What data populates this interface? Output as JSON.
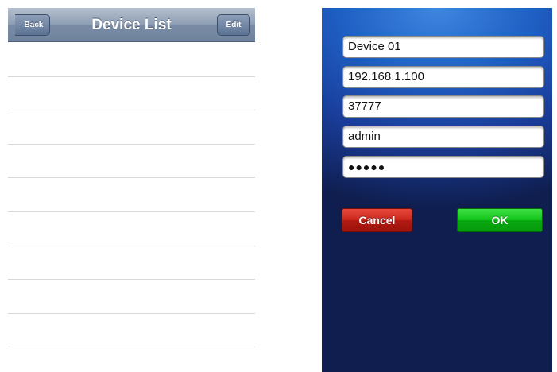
{
  "device_list_screen": {
    "title": "Device List",
    "back_label": "Back",
    "edit_label": "Edit",
    "rows": [
      "",
      "",
      "",
      "",
      "",
      "",
      "",
      "",
      "",
      ""
    ]
  },
  "device_form_screen": {
    "fields": {
      "name": "Device 01",
      "ip": "192.168.1.100",
      "port": "37777",
      "username": "admin",
      "password": "●●●●●"
    },
    "cancel_label": "Cancel",
    "ok_label": "OK"
  },
  "colors": {
    "navbar": "#8d9db2",
    "form_background": "#1f5fc4",
    "cancel": "#c9271c",
    "ok": "#12c41a"
  }
}
